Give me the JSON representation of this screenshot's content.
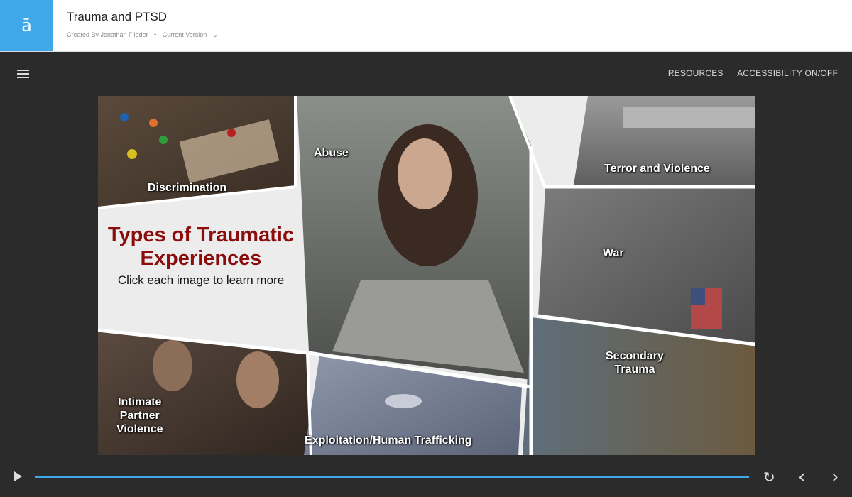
{
  "header": {
    "logo_glyph": "ā",
    "title": "Trauma and PTSD",
    "created_by": "Created By Jonathan Flieder",
    "separator": "•",
    "version": "Current Version",
    "version_chevron": "⌄"
  },
  "topbar": {
    "resources": "RESOURCES",
    "accessibility": "ACCESSIBILITY ON/OFF"
  },
  "slide": {
    "title": "Types of Traumatic Experiences",
    "subtitle": "Click each image to learn more",
    "panels": {
      "discrimination": "Discrimination",
      "abuse": "Abuse",
      "terror": "Terror and Violence",
      "war": "War",
      "secondary_line1": "Secondary",
      "secondary_line2": "Trauma",
      "ipv_line1": "Intimate",
      "ipv_line2": "Partner",
      "ipv_line3": "Violence",
      "exploitation": "Exploitation/Human Trafficking"
    }
  },
  "controls": {
    "progress": 1.0,
    "replay_glyph": "↻",
    "prev_glyph": "‹",
    "next_glyph": "›"
  },
  "colors": {
    "accent": "#3fa8e8",
    "title_red": "#8b0c0c",
    "background": "#2b2b2b"
  }
}
